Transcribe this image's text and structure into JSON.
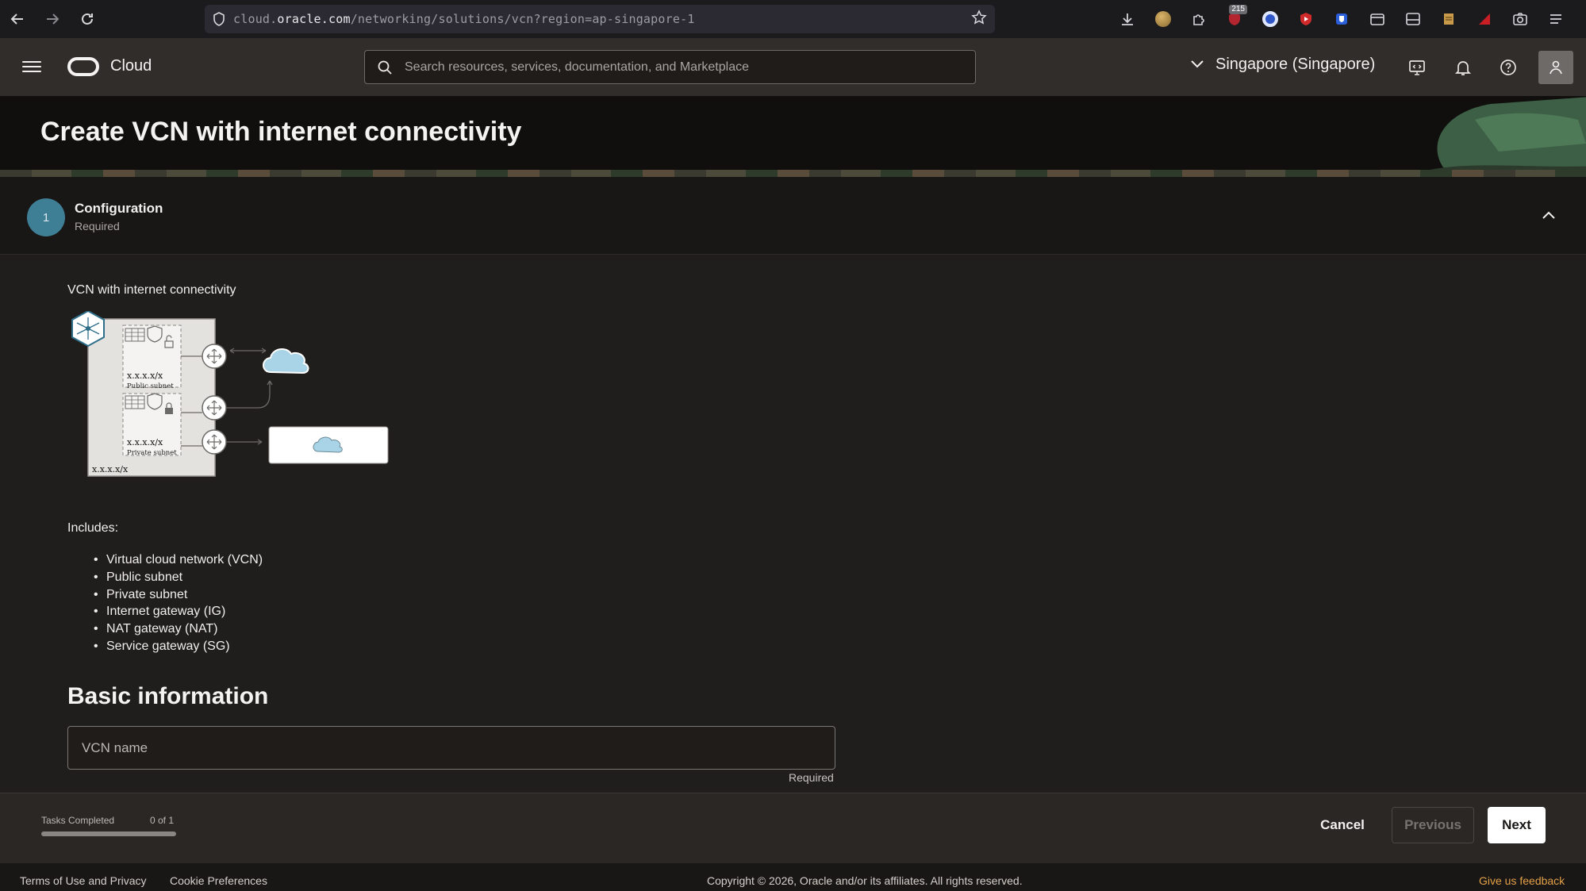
{
  "browser": {
    "url_prefix": "cloud.",
    "url_host": "oracle.com",
    "url_path": "/networking/solutions/vcn?region=ap-singapore-1",
    "extension_badge": "215"
  },
  "header": {
    "logo_text": "Cloud",
    "search_placeholder": "Search resources, services, documentation, and Marketplace",
    "region": "Singapore (Singapore)"
  },
  "page": {
    "title": "Create VCN with internet connectivity"
  },
  "step": {
    "number": "1",
    "title": "Configuration",
    "subtitle": "Required"
  },
  "content": {
    "diagram_label": "VCN with internet connectivity",
    "diagram": {
      "public_cidr": "x.x.x.x/x",
      "public_label": "Public subnet",
      "private_cidr": "x.x.x.x/x",
      "private_label": "Private subnet",
      "vcn_cidr": "x.x.x.x/x"
    },
    "includes_label": "Includes:",
    "includes": [
      "Virtual cloud network (VCN)",
      "Public subnet",
      "Private subnet",
      "Internet gateway (IG)",
      "NAT gateway (NAT)",
      "Service gateway (SG)"
    ],
    "basic_info_title": "Basic information",
    "vcn_name_placeholder": "VCN name",
    "vcn_name_value": "",
    "required_note": "Required"
  },
  "action_bar": {
    "tasks_label": "Tasks Completed",
    "tasks_count": "0 of 1",
    "tasks_progress": 0,
    "cancel_label": "Cancel",
    "previous_label": "Previous",
    "next_label": "Next"
  },
  "footer": {
    "terms": "Terms of Use and Privacy",
    "cookies": "Cookie Preferences",
    "copyright": "Copyright © 2026, Oracle and/or its affiliates. All rights reserved.",
    "feedback": "Give us feedback"
  },
  "colors": {
    "accent": "#3f7f96",
    "header_bg": "#312d2a",
    "feedback": "#e3a047"
  }
}
